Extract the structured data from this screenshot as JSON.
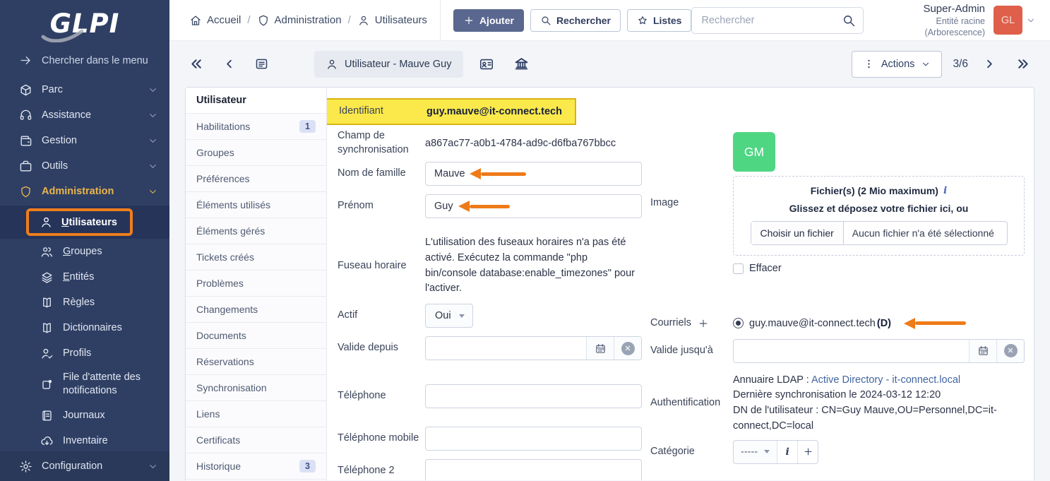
{
  "brand": {
    "logo_text": "GLPI"
  },
  "colors": {
    "sidebar_navy": "#2f3f64",
    "accent_orange_annotation": "#ee7b17",
    "highlight_yellow": "#fbe94b",
    "admin_gold": "#e9b44d",
    "avatar_green": "#4fd683",
    "avatar_red": "#df5f4a",
    "link_blue": "#41659f"
  },
  "sidebar": {
    "menu_hint": "Chercher dans le menu",
    "items": [
      {
        "label": "Parc",
        "icon": "box-icon"
      },
      {
        "label": "Assistance",
        "icon": "headset-icon"
      },
      {
        "label": "Gestion",
        "icon": "wallet-icon"
      },
      {
        "label": "Outils",
        "icon": "briefcase-icon"
      },
      {
        "label": "Administration",
        "icon": "shield-icon"
      }
    ],
    "admin_children": [
      {
        "label": "Utilisateurs",
        "icon": "user-icon",
        "active": true
      },
      {
        "label": "Groupes",
        "icon": "users-icon"
      },
      {
        "label": "Entités",
        "icon": "layers-icon"
      },
      {
        "label": "Règles",
        "icon": "book-icon"
      },
      {
        "label": "Dictionnaires",
        "icon": "book-icon"
      },
      {
        "label": "Profils",
        "icon": "user-check-icon"
      },
      {
        "label": "File d'attente des notifications",
        "icon": "notification-queue-icon"
      },
      {
        "label": "Journaux",
        "icon": "journal-icon"
      },
      {
        "label": "Inventaire",
        "icon": "cloud-download-icon"
      }
    ],
    "footer": {
      "label": "Configuration",
      "icon": "gear-icon"
    }
  },
  "header": {
    "breadcrumb": {
      "sep": "/",
      "items": [
        {
          "label": "Accueil",
          "icon": "home-icon"
        },
        {
          "label": "Administration",
          "icon": "shield-icon"
        },
        {
          "label": "Utilisateurs",
          "icon": "user-icon"
        }
      ]
    },
    "add_button": "Ajouter",
    "search_button": "Rechercher",
    "lists_button": "Listes",
    "global_search_placeholder": "Rechercher",
    "user_name": "Super-Admin",
    "user_entity": "Entité racine (Arborescence)",
    "avatar_initials": "GL"
  },
  "toolbar": {
    "tab_label": "Utilisateur - Mauve Guy",
    "actions_label": "Actions",
    "page_indicator": "3/6"
  },
  "tabs": [
    {
      "label": "Utilisateur",
      "active": true
    },
    {
      "label": "Habilitations",
      "badge": "1"
    },
    {
      "label": "Groupes"
    },
    {
      "label": "Préférences"
    },
    {
      "label": "Éléments utilisés"
    },
    {
      "label": "Éléments gérés"
    },
    {
      "label": "Tickets créés"
    },
    {
      "label": "Problèmes"
    },
    {
      "label": "Changements"
    },
    {
      "label": "Documents"
    },
    {
      "label": "Réservations"
    },
    {
      "label": "Synchronisation"
    },
    {
      "label": "Liens"
    },
    {
      "label": "Certificats"
    },
    {
      "label": "Historique",
      "badge": "3"
    }
  ],
  "form": {
    "identifiant": {
      "label": "Identifiant",
      "value": "guy.mauve@it-connect.tech"
    },
    "sync_field": {
      "label": "Champ de synchronisation",
      "value": "a867ac77-a0b1-4784-ad9c-d6fba767bbcc"
    },
    "lastname": {
      "label": "Nom de famille",
      "value": "Mauve"
    },
    "firstname": {
      "label": "Prénom",
      "value": "Guy"
    },
    "timezone": {
      "label": "Fuseau horaire",
      "value": "L'utilisation des fuseaux horaires n'a pas été activé. Exécutez la commande \"php bin/console database:enable_timezones\" pour l'activer."
    },
    "active": {
      "label": "Actif",
      "value": "Oui"
    },
    "valid_since": {
      "label": "Valide depuis",
      "value": ""
    },
    "phone": {
      "label": "Téléphone",
      "value": ""
    },
    "mobile": {
      "label": "Téléphone mobile",
      "value": ""
    },
    "phone2": {
      "label": "Téléphone 2",
      "value": ""
    },
    "image": {
      "label": "Image",
      "avatar_initials": "GM",
      "files_title": "Fichier(s) (2 Mio maximum)",
      "info_icon": "i",
      "drop_hint": "Glissez et déposez votre fichier ici, ou",
      "choose_button": "Choisir un fichier",
      "no_file": "Aucun fichier n'a été sélectionné",
      "clear_label": "Effacer"
    },
    "emails": {
      "label": "Courriels",
      "value": "guy.mauve@it-connect.tech",
      "default_suffix": "(D)"
    },
    "valid_until": {
      "label": "Valide jusqu'à",
      "value": ""
    },
    "auth": {
      "label": "Authentification",
      "ldap_prefix": "Annuaire LDAP : ",
      "ldap_link": "Active Directory - it-connect.local",
      "last_sync": "Dernière synchronisation le 2024-03-12 12:20",
      "dn": "DN de l'utilisateur : CN=Guy Mauve,OU=Personnel,DC=it-connect,DC=local"
    },
    "category": {
      "label": "Catégorie",
      "value": "-----",
      "info_button": "i"
    }
  }
}
